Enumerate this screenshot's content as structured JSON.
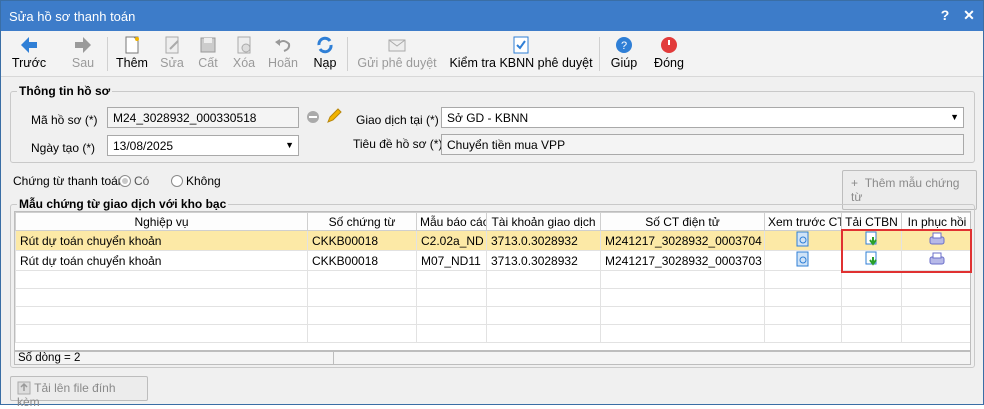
{
  "window": {
    "title": "Sửa hồ sơ thanh toán",
    "help_glyph": "?",
    "close_glyph": "✕"
  },
  "toolbar": {
    "prev": "Trước",
    "next": "Sau",
    "add": "Thêm",
    "edit": "Sửa",
    "save": "Cất",
    "delete": "Xóa",
    "undo": "Hoãn",
    "load": "Nạp",
    "send": "Gửi phê duyệt",
    "check": "Kiểm tra KBNN phê duyệt",
    "help": "Giúp",
    "close": "Đóng"
  },
  "info": {
    "group_title": "Thông tin hồ sơ",
    "code_label": "Mã hồ sơ (*)",
    "code_value": "M24_3028932_000330518",
    "date_label": "Ngày tạo (*)",
    "date_value": "13/08/2025",
    "place_label": "Giao dịch tại (*)",
    "place_value": "Sở GD - KBNN",
    "subject_label": "Tiêu đề hồ sơ (*)",
    "subject_value": "Chuyển tiền mua VPP"
  },
  "payment": {
    "label": "Chứng từ thanh toán:",
    "yes": "Có",
    "no": "Không",
    "add_template": "Thêm mẫu chứng từ"
  },
  "grid": {
    "group_title": "Mẫu chứng từ giao dịch với kho bạc",
    "headers": [
      "Nghiệp vụ",
      "Số chứng từ",
      "Mẫu báo cáo",
      "Tài khoản giao dịch",
      "Số CT điện tử",
      "Xem trước CT",
      "Tải CTBN",
      "In phục hồi"
    ],
    "rows": [
      {
        "type": "Rút dự toán chuyển khoản",
        "doc": "CKKB00018",
        "form": "C2.02a_ND",
        "account": "3713.0.3028932",
        "edoc": "M241217_3028932_0003704"
      },
      {
        "type": "Rút dự toán chuyển khoản",
        "doc": "CKKB00018",
        "form": "M07_ND11",
        "account": "3713.0.3028932",
        "edoc": "M241217_3028932_0003703"
      }
    ],
    "footer": "Số dòng = 2"
  },
  "attach_button": "Tải lên file đính kèm",
  "colors": {
    "titlebar": "#3d7cc9",
    "selected_row": "#fce9a6",
    "highlight_border": "#e03131"
  }
}
